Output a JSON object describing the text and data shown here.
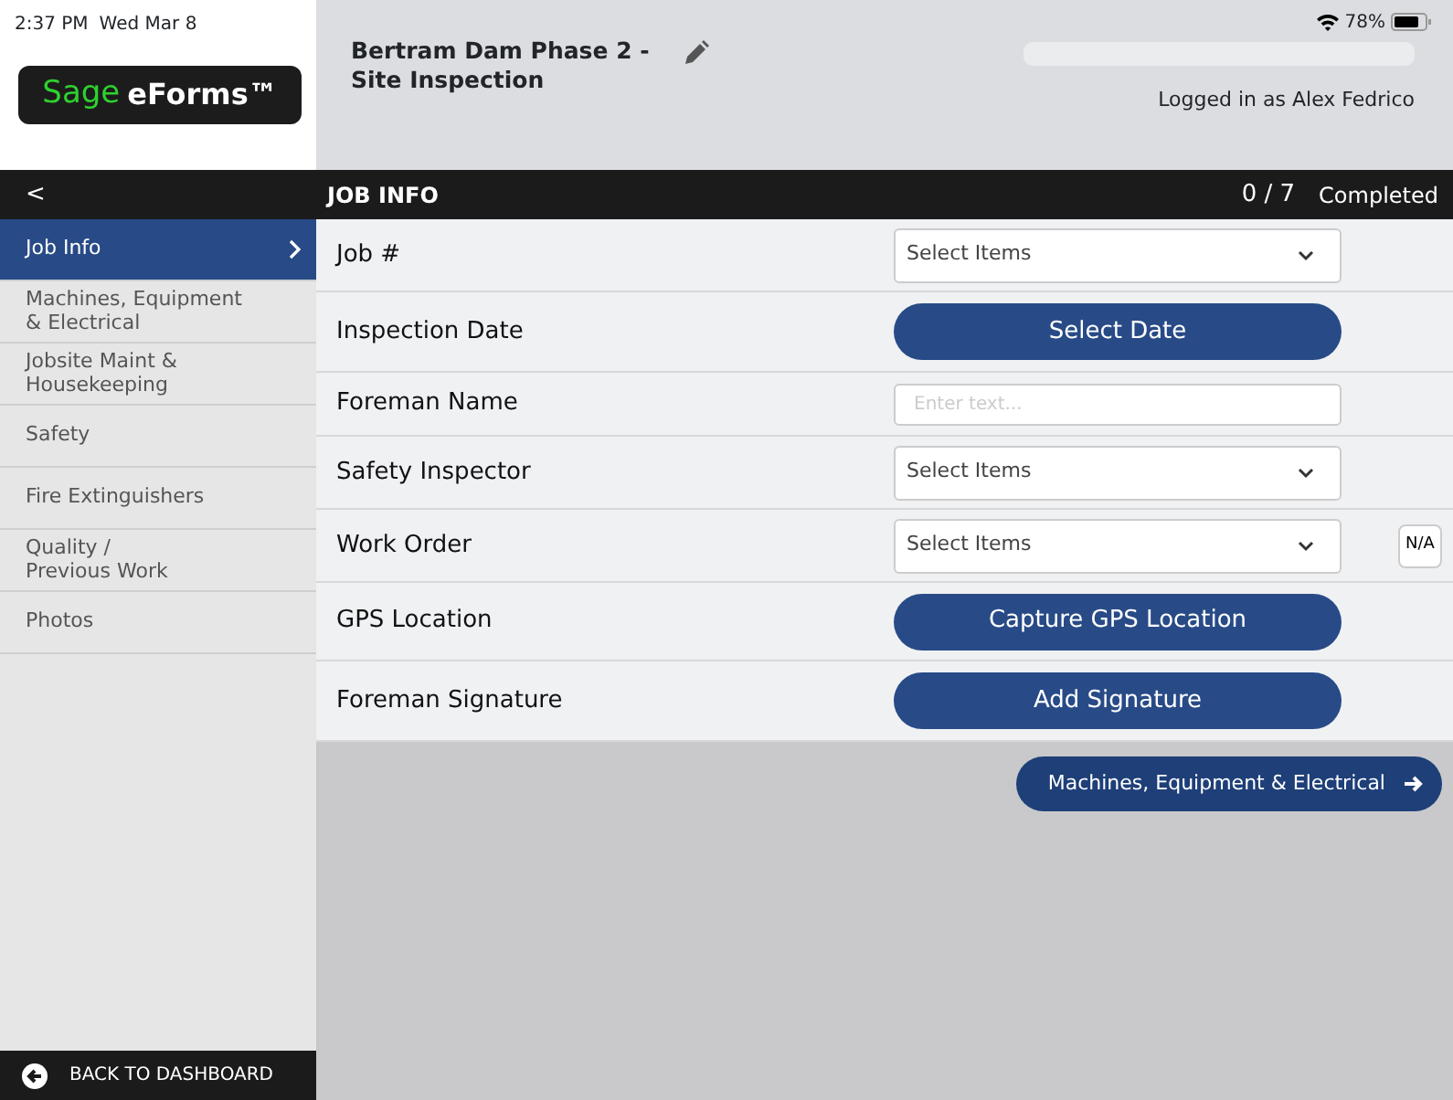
{
  "status_bar": {
    "time": "2:37 PM",
    "date": "Wed Mar 8",
    "battery": "78%"
  },
  "header": {
    "logo": {
      "brand": "Sage",
      "product": "eForms™"
    },
    "form_title": "Bertram Dam Phase 2 - Site Inspection",
    "logged_in": "Logged in as Alex Fedrico"
  },
  "section_bar": {
    "back": "<",
    "title": "JOB INFO",
    "count": "0 / 7",
    "status": "Completed"
  },
  "sidebar": {
    "items": [
      {
        "label": "Job Info",
        "selected": true
      },
      {
        "label": "Machines, Equipment\n& Electrical",
        "selected": false
      },
      {
        "label": "Jobsite Maint &\nHousekeeping",
        "selected": false
      },
      {
        "label": "Safety",
        "selected": false
      },
      {
        "label": "Fire Extinguishers",
        "selected": false
      },
      {
        "label": "Quality /\nPrevious Work",
        "selected": false
      },
      {
        "label": "Photos",
        "selected": false
      }
    ],
    "footer": "BACK TO DASHBOARD"
  },
  "fields": [
    {
      "label": "Job #",
      "kind": "select",
      "value": "Select Items"
    },
    {
      "label": "Inspection Date",
      "kind": "button",
      "value": "Select Date"
    },
    {
      "label": "Foreman Name",
      "kind": "text",
      "placeholder": "Enter text..."
    },
    {
      "label": "Safety Inspector",
      "kind": "select",
      "value": "Select Items"
    },
    {
      "label": "Work Order",
      "kind": "select",
      "value": "Select Items",
      "na": "N/A"
    },
    {
      "label": "GPS Location",
      "kind": "button",
      "value": "Capture GPS Location"
    },
    {
      "label": "Foreman Signature",
      "kind": "button",
      "value": "Add Signature"
    }
  ],
  "next_button": "Machines, Equipment & Electrical"
}
